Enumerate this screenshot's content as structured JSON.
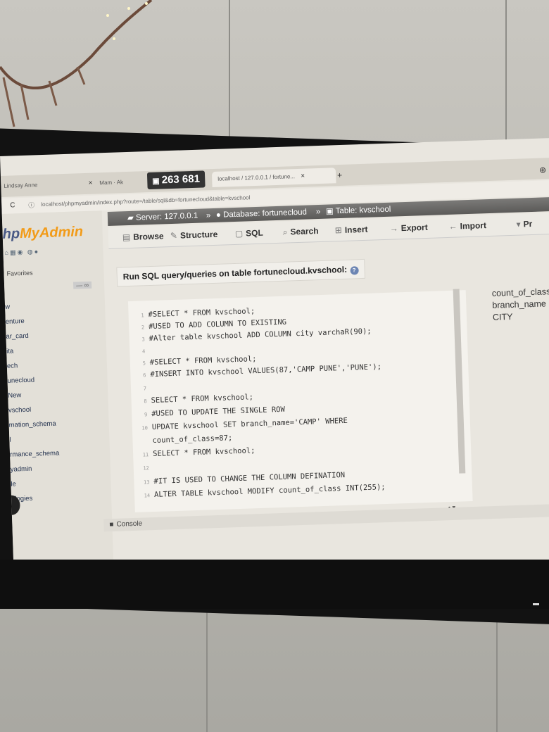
{
  "browser": {
    "tabs": [
      {
        "label": "Lindsay Anne"
      },
      {
        "label": "Mam · Ak"
      },
      {
        "label": "localhost / 127.0.0.1 / fortune..."
      }
    ],
    "badge": "263 681",
    "new_tab": "+",
    "url": "localhost/phpmyadmin/index.php?route=/table/sql&db=fortunecloud&table=kvschool"
  },
  "sidebar": {
    "logo_prefix": "hp",
    "logo_suffix": "MyAdmin",
    "favorites": "Favorites",
    "databases": [
      "w",
      "enture",
      "ar_card",
      "ita",
      "ech",
      "unecloud",
      "New",
      "vschool",
      "mation_schema",
      "l",
      "rmance_schema",
      "yadmin",
      "le",
      "ologies"
    ]
  },
  "breadcrumb": {
    "server": "Server: 127.0.0.1",
    "database": "Database: fortunecloud",
    "table": "Table: kvschool"
  },
  "tabs": {
    "browse": "Browse",
    "structure": "Structure",
    "sql": "SQL",
    "search": "Search",
    "insert": "Insert",
    "export": "Export",
    "import": "Import",
    "more": "Pr"
  },
  "sql_panel": {
    "title": "Run SQL query/queries on table fortunecloud.kvschool:",
    "lines": [
      {
        "n": "1",
        "text": "#SELECT * FROM kvschool;"
      },
      {
        "n": "2",
        "text": "#USED TO ADD COLUMN TO EXISTING"
      },
      {
        "n": "3",
        "text": "#Alter table kvschool ADD COLUMN city varchaR(90);"
      },
      {
        "n": "4",
        "text": ""
      },
      {
        "n": "5",
        "text": "#SELECT * FROM kvschool;"
      },
      {
        "n": "6",
        "text": "#INSERT INTO kvschool VALUES(87,'CAMP PUNE','PUNE');"
      },
      {
        "n": "7",
        "text": ""
      },
      {
        "n": "8",
        "text": "SELECT * FROM kvschool;"
      },
      {
        "n": "9",
        "text": "#USED TO UPDATE THE SINGLE ROW"
      },
      {
        "n": "10",
        "text": "UPDATE kvschool SET branch_name='CAMP' WHERE"
      },
      {
        "n": "",
        "text": "count_of_class=87;"
      },
      {
        "n": "11",
        "text": "SELECT * FROM kvschool;"
      },
      {
        "n": "12",
        "text": ""
      },
      {
        "n": "13",
        "text": "#IT IS USED TO CHANGE THE COLUMN DEFINATION"
      },
      {
        "n": "14",
        "text": "ALTER TABLE kvschool MODIFY count_of_class INT(255);"
      }
    ],
    "columns": [
      "count_of_class",
      "branch_name",
      "CITY"
    ]
  },
  "console": "Console"
}
